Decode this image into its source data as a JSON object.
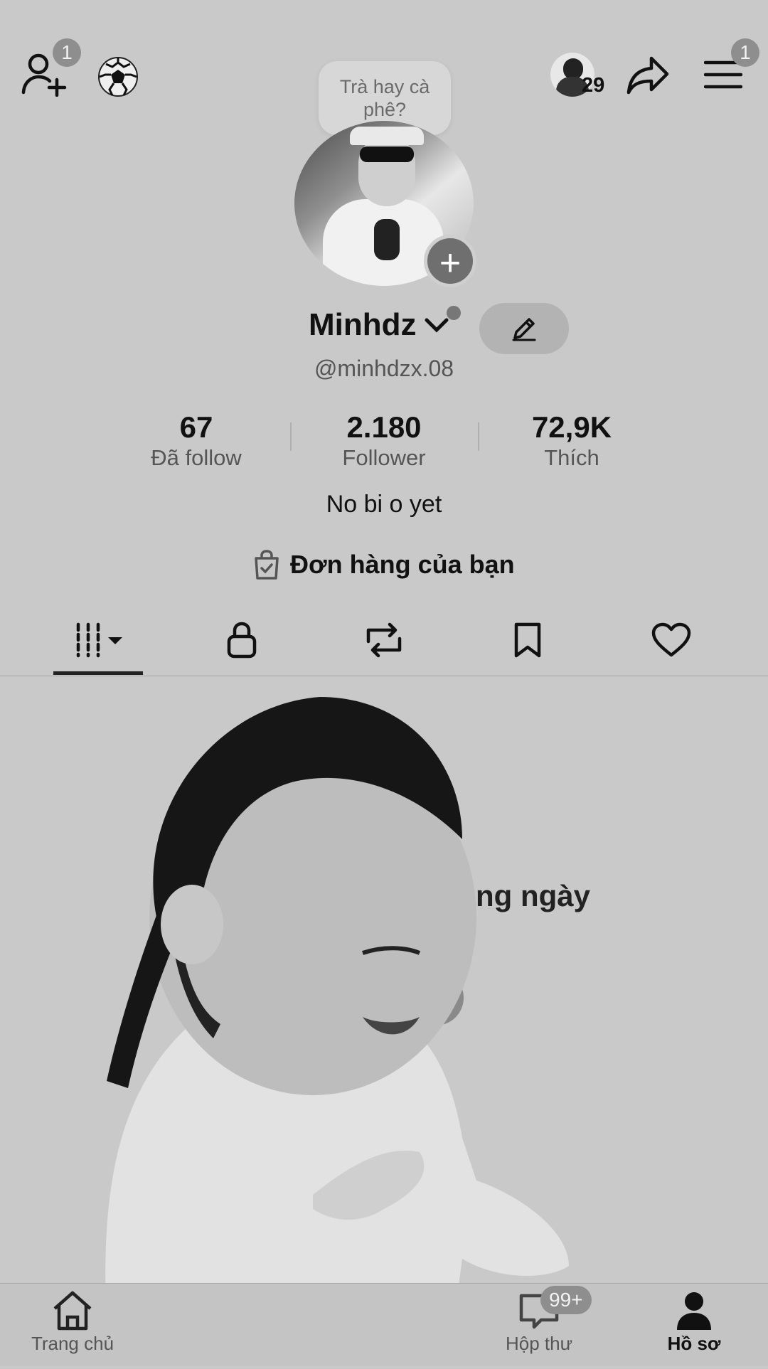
{
  "header": {
    "add_friend_badge": "1",
    "soccer_ball_icon": "soccer-ball-icon",
    "viewers_count": "29",
    "menu_badge": "1"
  },
  "profile": {
    "bubble_text": "Trà hay cà phê?",
    "display_name": "Minhdz",
    "handle": "@minhdzx.08",
    "bio": "No bi o yet",
    "orders_label": "Đơn hàng của bạn"
  },
  "stats": [
    {
      "value": "67",
      "label": "Đã follow"
    },
    {
      "value": "2.180",
      "label": "Follower"
    },
    {
      "value": "72,9K",
      "label": "Thích"
    }
  ],
  "tabs": [
    {
      "icon": "grid-videos-icon",
      "active": true
    },
    {
      "icon": "lock-icon"
    },
    {
      "icon": "repost-icon"
    },
    {
      "icon": "bookmark-icon"
    },
    {
      "icon": "heart-icon"
    }
  ],
  "content": {
    "overlay_text": "hằng ngày"
  },
  "bottom_nav": {
    "home": "Trang chủ",
    "inbox": "Hộp thư",
    "inbox_badge": "99+",
    "profile": "Hồ sơ"
  },
  "colors": {
    "background": "#c9c9c9",
    "badge": "#8e8e8e",
    "text": "#111111"
  }
}
